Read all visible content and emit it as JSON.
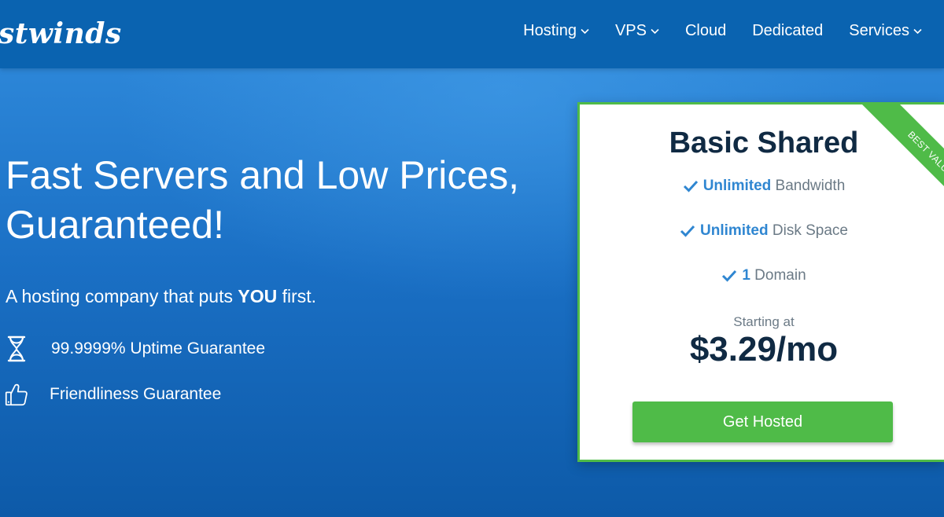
{
  "header": {
    "logo_text": "stwinds",
    "nav": [
      {
        "label": "Hosting",
        "has_dropdown": true
      },
      {
        "label": "VPS",
        "has_dropdown": true
      },
      {
        "label": "Cloud",
        "has_dropdown": false
      },
      {
        "label": "Dedicated",
        "has_dropdown": false
      },
      {
        "label": "Services",
        "has_dropdown": true
      }
    ]
  },
  "hero": {
    "headline_line1": "Fast Servers and Low Prices,",
    "headline_line2": "Guaranteed!",
    "subline_prefix": "A hosting company that puts ",
    "subline_emphasis": "YOU",
    "subline_suffix": " first.",
    "features": [
      {
        "icon": "hourglass-icon",
        "label": "99.9999% Uptime Guarantee"
      },
      {
        "icon": "thumbs-up-icon",
        "label": "Friendliness Guarantee"
      }
    ]
  },
  "plan_card": {
    "ribbon": "BEST VALUE",
    "title": "Basic Shared",
    "features": [
      {
        "highlight": "Unlimited",
        "text": " Bandwidth"
      },
      {
        "highlight": "Unlimited",
        "text": " Disk Space"
      },
      {
        "highlight": "1",
        "text": " Domain"
      }
    ],
    "starting_label": "Starting at",
    "price": "$3.29/mo",
    "cta_label": "Get Hosted"
  },
  "colors": {
    "header_bg": "#0a63b0",
    "hero_bg": "#1a6fc4",
    "accent_green": "#4fbb48",
    "highlight_blue": "#2f86d1",
    "dark_text": "#102a43"
  }
}
